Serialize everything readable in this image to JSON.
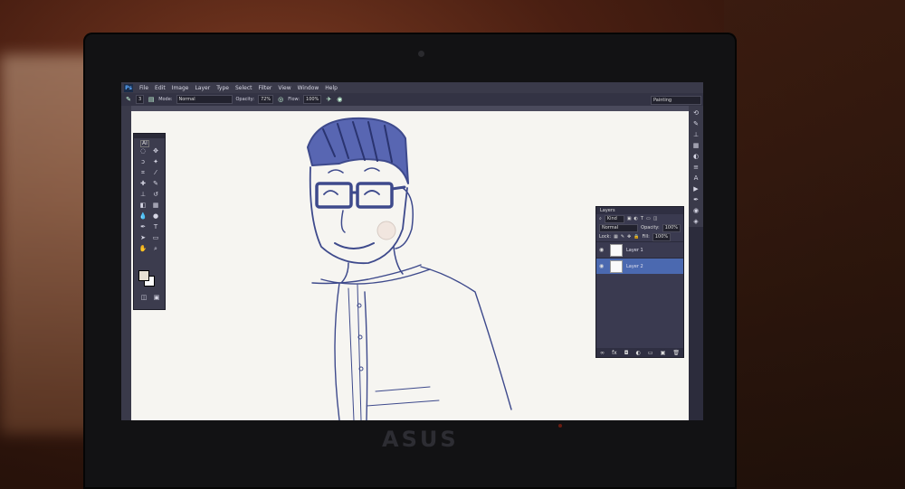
{
  "app": {
    "logo": "Ps"
  },
  "menus": [
    "File",
    "Edit",
    "Image",
    "Layer",
    "Type",
    "Select",
    "Filter",
    "View",
    "Window",
    "Help"
  ],
  "options": {
    "brush_size": "3",
    "mode_label": "Mode:",
    "mode_value": "Normal",
    "opacity_label": "Opacity:",
    "opacity_value": "72%",
    "flow_label": "Flow:",
    "flow_value": "100%",
    "workspace": "Painting"
  },
  "toolbox": {
    "badge": "AI",
    "foreground_color": "#e6e0d2",
    "background_color": "#fafafa"
  },
  "layers_panel": {
    "title": "Layers",
    "kind_label": "Kind",
    "blend_mode": "Normal",
    "opacity_label": "Opacity:",
    "opacity_value": "100%",
    "lock_label": "Lock:",
    "fill_label": "Fill:",
    "fill_value": "100%",
    "layers": [
      {
        "name": "Layer 1",
        "active": false
      },
      {
        "name": "Layer 2",
        "active": true
      }
    ]
  },
  "device": {
    "brand": "ASUS"
  },
  "colors": {
    "selection": "#4b69b0",
    "sketch_ink": "#3e4a8c"
  }
}
